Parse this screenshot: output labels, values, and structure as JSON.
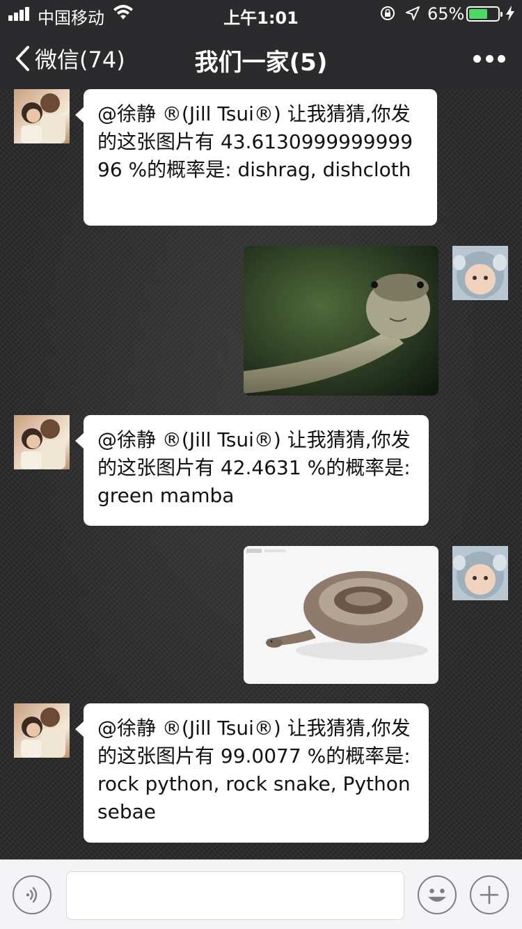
{
  "status_bar": {
    "carrier": "中国移动",
    "time": "上午1:01",
    "battery_percent": "65%",
    "battery_level": 0.65,
    "battery_color": "#4cd964"
  },
  "nav": {
    "back_label": "微信(74)",
    "title": "我们一家(5)"
  },
  "messages": [
    {
      "sender": "other",
      "text": "@徐静 ®(Jill Tsui®) 让我猜猜,你发的这张图片有 43.613099999999996 %的概率是: dishrag, dishcloth"
    },
    {
      "sender": "self",
      "type": "image",
      "image": "green-snake-photo"
    },
    {
      "sender": "other",
      "text": "@徐静 ®(Jill Tsui®) 让我猜猜,你发的这张图片有 42.4631 %的概率是: green mamba"
    },
    {
      "sender": "self",
      "type": "image",
      "image": "coiled-snake-photo"
    },
    {
      "sender": "other",
      "text": "@徐静 ®(Jill Tsui®) 让我猜猜,你发的这张图片有 99.0077 %的概率是: rock python, rock snake, Python sebae"
    }
  ],
  "input_bar": {
    "value": "",
    "icons": [
      "voice-icon",
      "emoji-icon",
      "plus-icon"
    ]
  }
}
